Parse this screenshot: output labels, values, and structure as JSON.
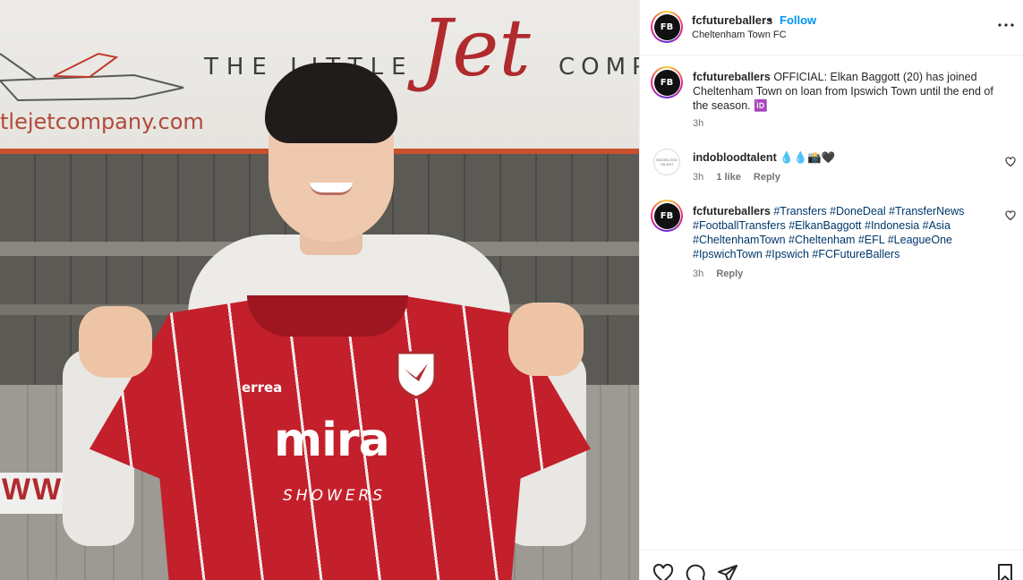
{
  "photo": {
    "banner_text_left": "THE LITTLE",
    "banner_script": "Jet",
    "banner_text_right": "COMP",
    "banner_url": "tlejetcompany.com",
    "wall_sign": "WW",
    "kit_brand": "errea",
    "sponsor": "mira",
    "sponsor_sub": "SHOWERS"
  },
  "header": {
    "avatar_text": "FB",
    "username": "fcfutureballers",
    "dot": "•",
    "follow_label": "Follow",
    "location": "Cheltenham Town FC"
  },
  "caption": {
    "avatar_text": "FB",
    "username": "fcfutureballers",
    "text": "OFFICIAL: Elkan Baggott (20) has joined Cheltenham Town on loan from Ipswich Town until the end of the season. 🆔",
    "time": "3h"
  },
  "comments": [
    {
      "avatar_text": "INDOBLOOD TALENT",
      "username": "indobloodtalent",
      "text": "💧💧📸🖤",
      "time": "3h",
      "likes": "1 like",
      "reply": "Reply"
    },
    {
      "avatar_text": "FB",
      "username": "fcfutureballers",
      "text": "#Transfers #DoneDeal #TransferNews #FootballTransfers #ElkanBaggott #Indonesia #Asia #CheltenhamTown #Cheltenham #EFL #LeagueOne #IpswichTown #Ipswich #FCFutureBallers",
      "time": "3h",
      "reply": "Reply"
    }
  ],
  "icons": [
    "more-options-icon",
    "heart-icon",
    "comment-icon",
    "share-icon",
    "bookmark-icon"
  ]
}
